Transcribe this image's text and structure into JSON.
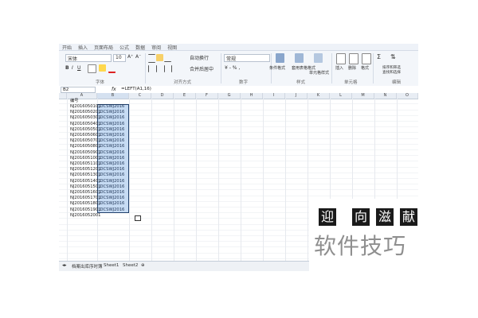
{
  "menu": {
    "items": [
      "开始",
      "插入",
      "页面布局",
      "公式",
      "数据",
      "审阅",
      "视图"
    ]
  },
  "ribbon": {
    "font_name": "宋体",
    "font_size": "10",
    "font_group": "字体",
    "align_group": "对齐方式",
    "number_group": "数字",
    "style_group": "样式",
    "cell_group": "单元格",
    "edit_group": "编辑",
    "wrap_text": "自动换行",
    "merge_center": "合并后居中",
    "number_format": "常规",
    "cond_format": "条件格式",
    "table_format": "套用表格格式",
    "cell_style": "单元格样式",
    "insert": "插入",
    "delete": "删除",
    "format": "格式",
    "sort_filter": "排序和筛选",
    "find_select": "查找和选择"
  },
  "formula_bar": {
    "name_box": "B2",
    "fx": "fx",
    "formula": "=LEFT(A1,16)"
  },
  "columns": [
    "A",
    "B",
    "C",
    "D",
    "E",
    "F",
    "G",
    "H",
    "I",
    "J",
    "K",
    "L",
    "M",
    "N",
    "O"
  ],
  "column_a": {
    "header": "编号",
    "values": [
      "NJ2016050101",
      "NJ2016050201",
      "NJ2016050301",
      "NJ2016050401",
      "NJ2016050501",
      "NJ2016050601",
      "NJ2016050701",
      "NJ2016050801",
      "NJ2016050901",
      "NJ2016051001",
      "NJ2016051101",
      "NJ2016051201",
      "NJ2016051301",
      "NJ2016051401",
      "NJ2016051501",
      "NJ2016051601",
      "NJ2016051701",
      "NJ2016051801",
      "NJ2016051901",
      "NJ2016052001"
    ]
  },
  "column_b": {
    "values": [
      "JDCSWJ2016",
      "JDCSWJ2016",
      "JDCSWJ2016",
      "JDCSWJ2016",
      "JDCSWJ2016",
      "JDCSWJ2016",
      "JDCSWJ2016",
      "JDCSWJ2016",
      "JDCSWJ2016",
      "JDCSWJ2016",
      "JDCSWJ2016",
      "JDCSWJ2016",
      "JDCSWJ2016",
      "JDCSWJ2016",
      "JDCSWJ2016",
      "JDCSWJ2016",
      "JDCSWJ2016",
      "JDCSWJ2016",
      "JDCSWJ2016"
    ]
  },
  "sheet_tabs": [
    "档案出库序时簿",
    "Sheet1",
    "Sheet2"
  ],
  "overlay": {
    "chars": [
      "迎",
      "向",
      "滋",
      "献"
    ],
    "title": "软件技巧"
  },
  "colors": {
    "selection": "#c6dbf3",
    "selection_border": "#1f3f6b",
    "ribbon_bg": "#f3f6fa"
  }
}
